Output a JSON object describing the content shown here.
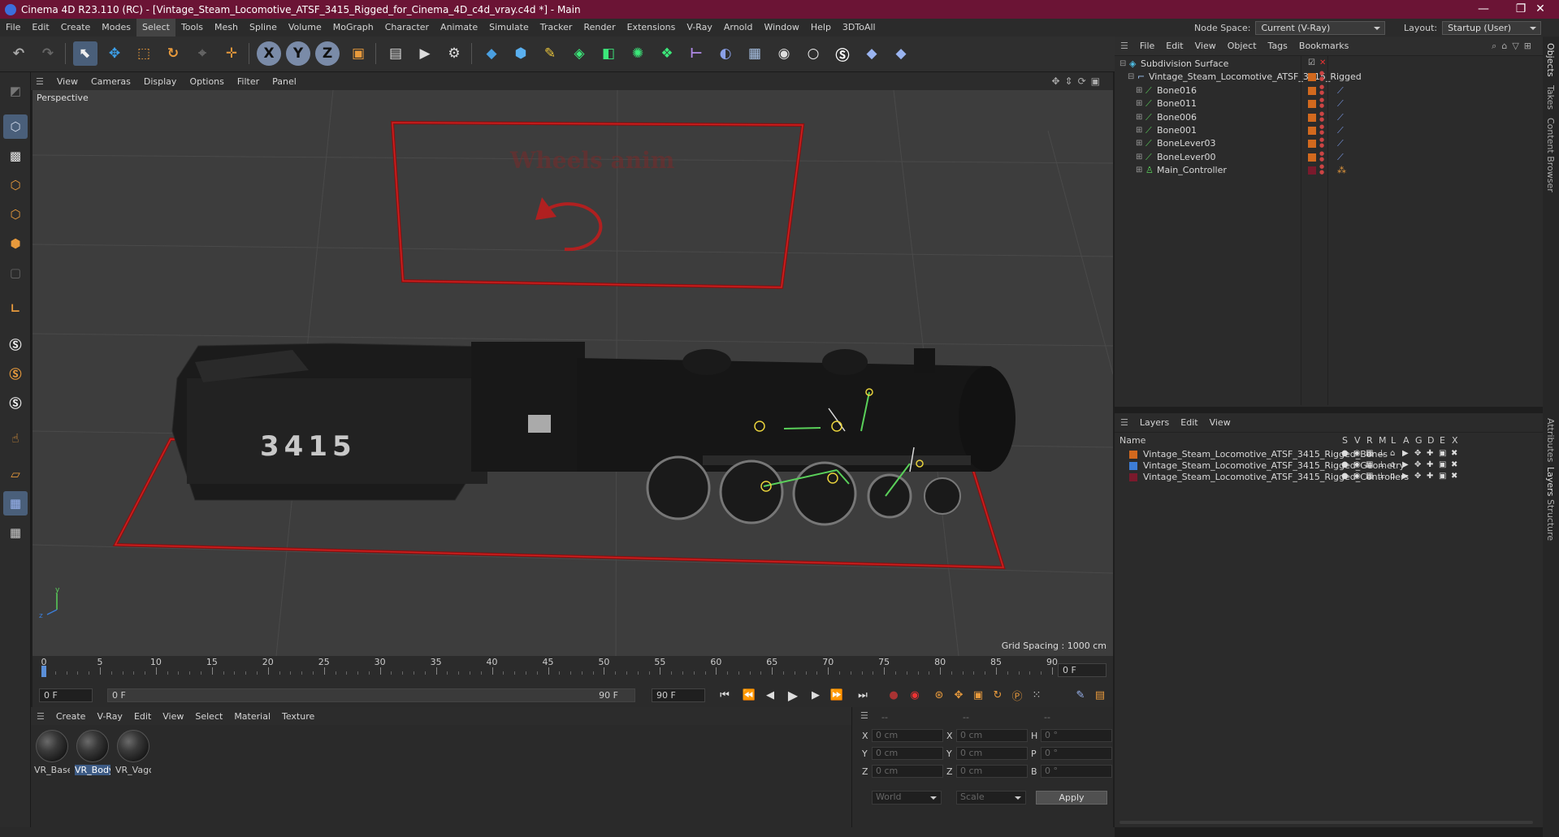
{
  "window": {
    "title": "Cinema 4D R23.110 (RC) - [Vintage_Steam_Locomotive_ATSF_3415_Rigged_for_Cinema_4D_c4d_vray.c4d *] - Main",
    "minimize": "—",
    "maximize": "❐",
    "close": "✕"
  },
  "menu": {
    "items": [
      "File",
      "Edit",
      "Create",
      "Modes",
      "Select",
      "Tools",
      "Mesh",
      "Spline",
      "Volume",
      "MoGraph",
      "Character",
      "Animate",
      "Simulate",
      "Tracker",
      "Render",
      "Extensions",
      "V-Ray",
      "Arnold",
      "Window",
      "Help",
      "3DToAll"
    ],
    "active": "Select",
    "node_space_label": "Node Space:",
    "node_space_value": "Current (V-Ray)",
    "layout_label": "Layout:",
    "layout_value": "Startup (User)"
  },
  "toolbar": {
    "axis_x": "X",
    "axis_y": "Y",
    "axis_z": "Z"
  },
  "viewport": {
    "menu": [
      "View",
      "Cameras",
      "Display",
      "Options",
      "Filter",
      "Panel"
    ],
    "label": "Perspective",
    "grid_spacing": "Grid Spacing : 1000 cm",
    "floor_text": "Wheels anim",
    "loco_number": "3415",
    "axis_y": "y",
    "axis_z": "z"
  },
  "timeline": {
    "ticks": [
      "0",
      "5",
      "10",
      "15",
      "20",
      "25",
      "30",
      "35",
      "40",
      "45",
      "50",
      "55",
      "60",
      "65",
      "70",
      "75",
      "80",
      "85",
      "90"
    ],
    "current_frame": "0 F"
  },
  "transport": {
    "start": "0 F",
    "range_start": "0 F",
    "range_end": "90 F",
    "end": "90 F"
  },
  "materials": {
    "menu": [
      "Create",
      "V-Ray",
      "Edit",
      "View",
      "Select",
      "Material",
      "Texture"
    ],
    "items": [
      {
        "name": "VR_Base",
        "selected": false
      },
      {
        "name": "VR_Body",
        "selected": true
      },
      {
        "name": "VR_Vagc",
        "selected": false
      }
    ]
  },
  "coords": {
    "headers": [
      "--",
      "--",
      "--"
    ],
    "rows": [
      {
        "a": "X",
        "av": "0 cm",
        "b": "X",
        "bv": "0 cm",
        "c": "H",
        "cv": "0 °"
      },
      {
        "a": "Y",
        "av": "0 cm",
        "b": "Y",
        "bv": "0 cm",
        "c": "P",
        "cv": "0 °"
      },
      {
        "a": "Z",
        "av": "0 cm",
        "b": "Z",
        "bv": "0 cm",
        "c": "B",
        "cv": "0 °"
      }
    ],
    "world": "World",
    "scale": "Scale",
    "apply": "Apply"
  },
  "objects": {
    "menu": [
      "File",
      "Edit",
      "View",
      "Object",
      "Tags",
      "Bookmarks"
    ],
    "items": [
      {
        "name": "Subdivision Surface",
        "level": 0,
        "color": "#aaaaaa"
      },
      {
        "name": "Vintage_Steam_Locomotive_ATSF_3415_Rigged",
        "level": 1,
        "color": "#d2691e"
      },
      {
        "name": "Bone016",
        "level": 2,
        "color": "#d2691e"
      },
      {
        "name": "Bone011",
        "level": 2,
        "color": "#d2691e"
      },
      {
        "name": "Bone006",
        "level": 2,
        "color": "#d2691e"
      },
      {
        "name": "Bone001",
        "level": 2,
        "color": "#d2691e"
      },
      {
        "name": "BoneLever03",
        "level": 2,
        "color": "#d2691e"
      },
      {
        "name": "BoneLever00",
        "level": 2,
        "color": "#d2691e"
      },
      {
        "name": "Main_Controller",
        "level": 2,
        "color": "#7a1a2c"
      }
    ]
  },
  "layers": {
    "menu": [
      "Layers",
      "Edit",
      "View"
    ],
    "header_name": "Name",
    "header_flags": [
      "S",
      "V",
      "R",
      "M",
      "L",
      "A",
      "G",
      "D",
      "E",
      "X"
    ],
    "items": [
      {
        "name": "Vintage_Steam_Locomotive_ATSF_3415_Rigged_Bones",
        "color": "#d2691e"
      },
      {
        "name": "Vintage_Steam_Locomotive_ATSF_3415_Rigged_Geometry",
        "color": "#3d7dd6"
      },
      {
        "name": "Vintage_Steam_Locomotive_ATSF_3415_Rigged_Controllers",
        "color": "#7a1a2c"
      }
    ]
  },
  "side_tabs": [
    "Objects",
    "Takes",
    "Content Browser",
    "Attributes",
    "Layers",
    "Structure"
  ]
}
